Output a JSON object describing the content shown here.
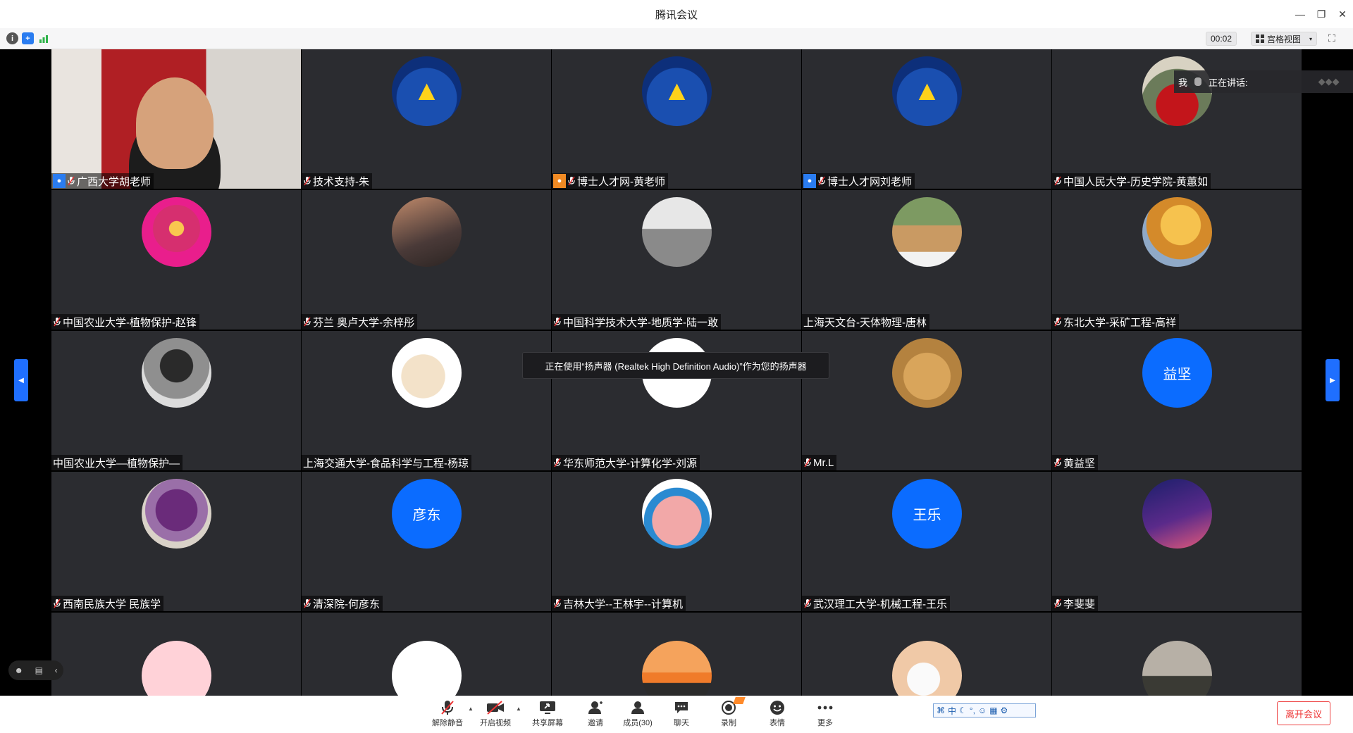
{
  "window": {
    "title": "腾讯会议",
    "minimize": "—",
    "restore": "❐",
    "close": "✕"
  },
  "topbar": {
    "timer": "00:02",
    "view_label": "宫格视图",
    "view_caret": "▾",
    "fullscreen": "⛶"
  },
  "speaking": {
    "me": "我",
    "label": "正在讲话:"
  },
  "toast": "正在使用“扬声器 (Realtek High Definition Audio)”作为您的扬声器",
  "participants": [
    {
      "name": "广西大学胡老师",
      "mic": true,
      "host": "blue",
      "avatar": "video"
    },
    {
      "name": "技术支持-朱",
      "mic": true,
      "host": "",
      "avatar": "cap"
    },
    {
      "name": "博士人才网-黄老师",
      "mic": true,
      "host": "orange",
      "avatar": "cap"
    },
    {
      "name": "博士人才网刘老师",
      "mic": true,
      "host": "blue",
      "avatar": "cap"
    },
    {
      "name": "中国人民大学-历史学院-黄蕙如",
      "mic": true,
      "host": "",
      "avatar": "lantern"
    },
    {
      "name": "中国农业大学-植物保护-赵锋",
      "mic": true,
      "host": "",
      "avatar": "pink-art"
    },
    {
      "name": "芬兰 奥卢大学-余梓彤",
      "mic": true,
      "host": "",
      "avatar": "sunset-people"
    },
    {
      "name": "中国科学技术大学-地质学-陆一敢",
      "mic": true,
      "host": "",
      "avatar": "runner"
    },
    {
      "name": "上海天文台-天体物理-唐林",
      "mic": false,
      "host": "",
      "avatar": "map-room"
    },
    {
      "name": "东北大学-采矿工程-高祥",
      "mic": true,
      "host": "",
      "avatar": "autumn"
    },
    {
      "name": "中国农业大学—植物保护—",
      "mic": false,
      "host": "",
      "avatar": "blurred"
    },
    {
      "name": "上海交通大学-食品科学与工程-杨琼",
      "mic": false,
      "host": "",
      "avatar": "hamster"
    },
    {
      "name": "华东师范大学-计算化学-刘源",
      "mic": true,
      "host": "",
      "avatar": "molecule"
    },
    {
      "name": "Mr.L",
      "mic": true,
      "host": "",
      "avatar": "cat"
    },
    {
      "name": "黄益坚",
      "mic": true,
      "host": "",
      "avatar": "text",
      "initials": "益坚"
    },
    {
      "name": "西南民族大学 民族学",
      "mic": true,
      "host": "",
      "avatar": "flower"
    },
    {
      "name": "清深院-何彦东",
      "mic": true,
      "host": "",
      "avatar": "text",
      "initials": "彦东"
    },
    {
      "name": "吉林大学--王林宇--计算机",
      "mic": true,
      "host": "",
      "avatar": "pig"
    },
    {
      "name": "武汉理工大学-机械工程-王乐",
      "mic": true,
      "host": "",
      "avatar": "text",
      "initials": "王乐"
    },
    {
      "name": "李斐斐",
      "mic": true,
      "host": "",
      "avatar": "night-sky"
    },
    {
      "name": "",
      "mic": false,
      "host": "",
      "avatar": "pink-blob"
    },
    {
      "name": "",
      "mic": false,
      "host": "",
      "avatar": "ultraman"
    },
    {
      "name": "",
      "mic": false,
      "host": "",
      "avatar": "sunset-lake"
    },
    {
      "name": "",
      "mic": false,
      "host": "",
      "avatar": "baby-mask"
    },
    {
      "name": "",
      "mic": false,
      "host": "",
      "avatar": "dusk-bike"
    }
  ],
  "bottombar": {
    "unmute": "解除静音",
    "video": "开启视频",
    "share": "共享屏幕",
    "invite": "邀请",
    "members": "成员(30)",
    "chat": "聊天",
    "record": "录制",
    "emoji": "表情",
    "more": "更多",
    "leave": "离开会议",
    "ime_text": "中"
  },
  "colors": {
    "accent": "#1f6fff",
    "tile_bg": "#2b2c30",
    "leave": "#e33333",
    "initials_bg": "#0b6cff"
  }
}
